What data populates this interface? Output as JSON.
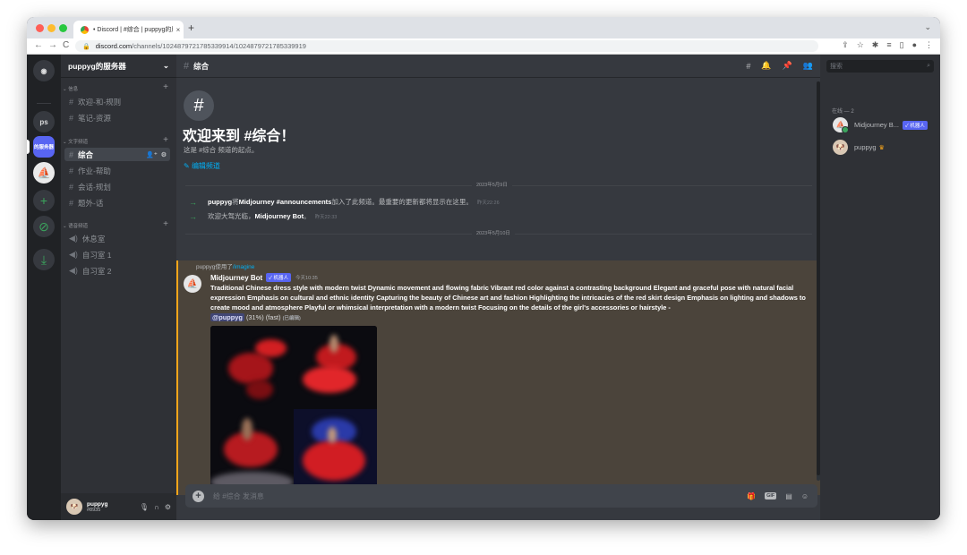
{
  "browser": {
    "tab_title": "• Discord | #综合 | puppyg的服",
    "tab_close": "×",
    "new_tab": "+",
    "url_host": "discord.com",
    "url_path": "/channels/1024879721785339914/1024879721785339919",
    "nav": {
      "back": "←",
      "forward": "→",
      "reload": "C"
    }
  },
  "guilds": {
    "home_label": "◉",
    "items": [
      "ps",
      "的服务器"
    ],
    "add_label": "+",
    "explore_label": "⊘",
    "download_label": "⤓"
  },
  "server": {
    "name": "puppyg的服务器",
    "categories": [
      {
        "label": "信息",
        "channels": [
          "欢迎-和-规则",
          "笔记-资源"
        ]
      },
      {
        "label": "文字频道",
        "channels": [
          "综合",
          "作业-帮助",
          "会话-规划",
          "题外-话"
        ]
      },
      {
        "label": "语音频道",
        "channels": [
          "休息室",
          "自习室 1",
          "自习室 2"
        ]
      }
    ]
  },
  "user": {
    "name": "puppyg",
    "tag": "#8935"
  },
  "channel": {
    "name": "综合",
    "welcome_title": "欢迎来到 #综合！",
    "welcome_sub": "这是 #综合 频道的起点。",
    "edit_label": "编辑频道"
  },
  "messages": {
    "date1": "2023年5月9日",
    "sys1": {
      "user": "puppyg",
      "text1": " 将 ",
      "bot": "Midjourney #announcements",
      "text2": " 加入了此频道。最重要的更新都将显示在这里。",
      "time": "昨天22:26"
    },
    "sys2": {
      "text1": "欢迎大驾光临，",
      "bot": "Midjourney Bot",
      "text2": "。",
      "time": "昨天22:33"
    },
    "date2": "2023年5月10日",
    "reply": {
      "user": "puppyg使用了",
      "command": "/imagine"
    },
    "bot_name": "Midjourney Bot",
    "bot_badge": "✓ 机器人",
    "bot_time": "今天10:35",
    "prompt": "Traditional Chinese dress style with modern twist Dynamic movement and flowing fabric Vibrant red color against a contrasting background Elegant and graceful pose with natural facial expression Emphasis on cultural and ethnic identity Capturing the beauty of Chinese art and fashion Highlighting the intricacies of the red skirt design Emphasis on lighting and shadows to create mood and atmosphere Playful or whimsical interpretation with a modern twist Focusing on the details of the girl's accessories or hairstyle -",
    "mention": "@puppyg",
    "progress": "(31%) (fast)",
    "edited": "(已编辑)"
  },
  "composer": {
    "placeholder": "给 #综合 发消息",
    "gif_label": "GIF"
  },
  "members": {
    "search_placeholder": "搜索",
    "category": "在线 — 2",
    "list": [
      {
        "name": "Midjourney B...",
        "badge": "✓ 机器人"
      },
      {
        "name": "puppyg",
        "badge": "♛"
      }
    ]
  },
  "colors": {
    "accent": "#5865f2",
    "online": "#3ba55d",
    "highlight_bar": "#faa61a",
    "link": "#00aff4"
  }
}
